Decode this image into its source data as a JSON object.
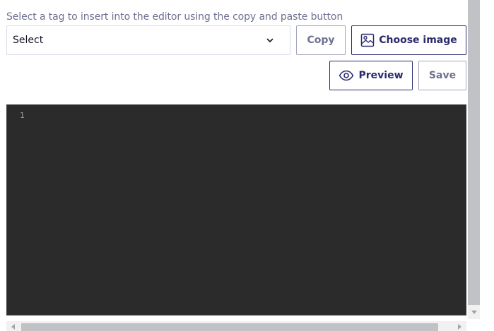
{
  "toolbar": {
    "hint": "Select a tag to insert into the editor using the copy and paste button",
    "tag_select": {
      "selected": "Select"
    },
    "copy_label": "Copy",
    "choose_image_label": "Choose image",
    "preview_label": "Preview",
    "save_label": "Save"
  },
  "editor": {
    "line_numbers": [
      "1"
    ],
    "content": ""
  },
  "icons": {
    "select_chevron": "chevron-down-icon",
    "choose_image": "image-icon",
    "preview": "eye-icon"
  },
  "colors": {
    "primary": "#2a2a6e",
    "muted": "#6e7191",
    "editor_bg": "#2b2b2b"
  }
}
